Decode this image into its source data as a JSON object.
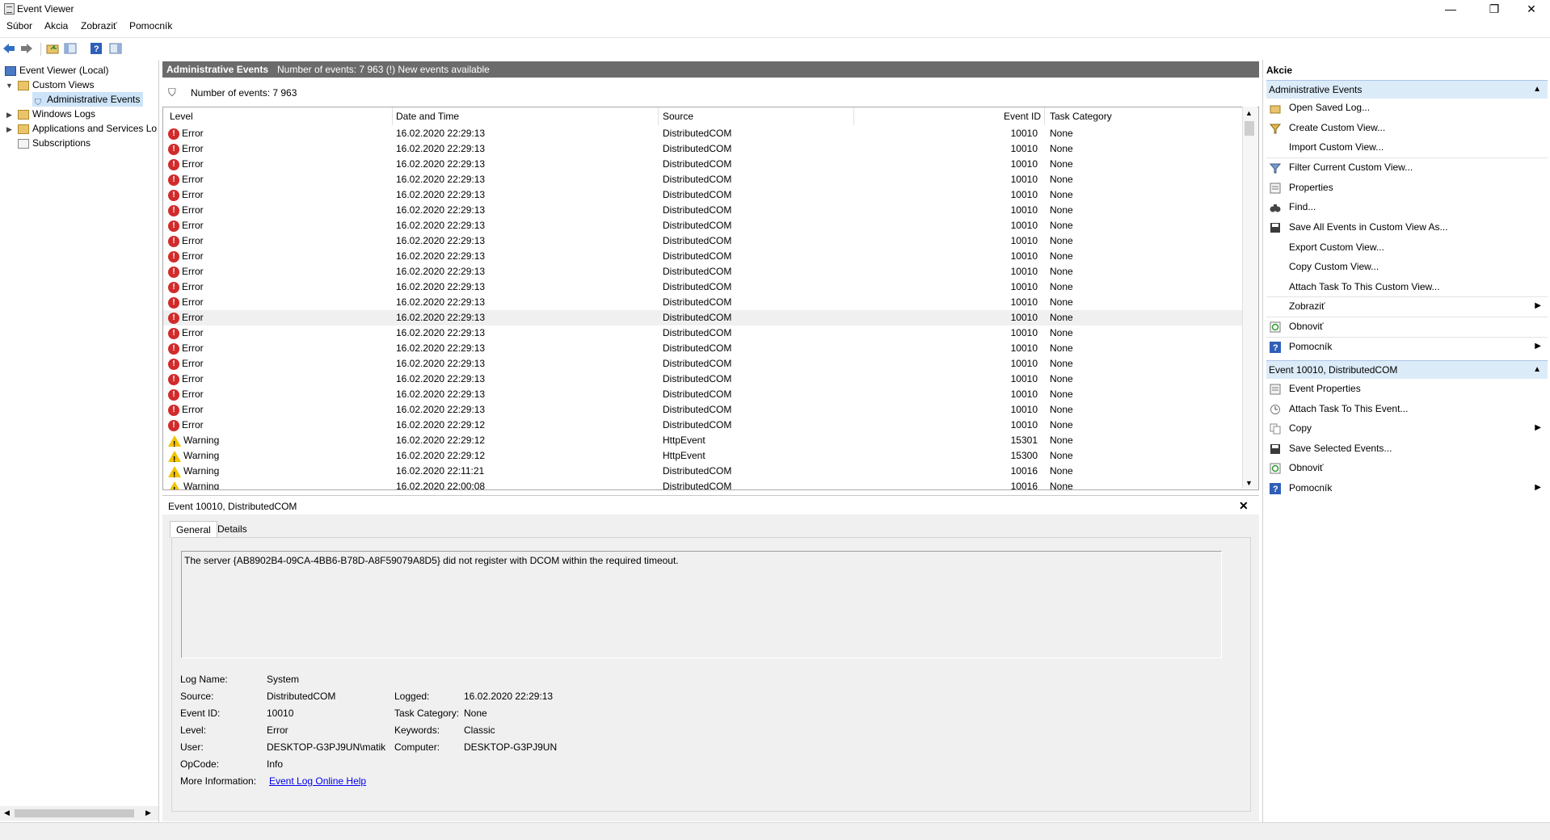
{
  "window": {
    "title": "Event Viewer",
    "minimize": "—",
    "restore": "❐",
    "close": "✕"
  },
  "menu": [
    "Súbor",
    "Akcia",
    "Zobraziť",
    "Pomocník"
  ],
  "tree": {
    "root": "Event Viewer (Local)",
    "custom_views": "Custom Views",
    "administrative_events": "Administrative Events",
    "windows_logs": "Windows Logs",
    "applications": "Applications and Services Lo",
    "subscriptions": "Subscriptions"
  },
  "center": {
    "header_title": "Administrative Events",
    "header_info": "Number of events: 7 963 (!) New events available",
    "filter_text": "Number of events: 7 963",
    "columns": {
      "level": "Level",
      "date": "Date and Time",
      "source": "Source",
      "event_id": "Event ID",
      "task": "Task Category"
    },
    "rows": [
      {
        "level": "Error",
        "date": "16.02.2020 22:29:13",
        "source": "DistributedCOM",
        "id": "10010",
        "task": "None"
      },
      {
        "level": "Error",
        "date": "16.02.2020 22:29:13",
        "source": "DistributedCOM",
        "id": "10010",
        "task": "None"
      },
      {
        "level": "Error",
        "date": "16.02.2020 22:29:13",
        "source": "DistributedCOM",
        "id": "10010",
        "task": "None"
      },
      {
        "level": "Error",
        "date": "16.02.2020 22:29:13",
        "source": "DistributedCOM",
        "id": "10010",
        "task": "None"
      },
      {
        "level": "Error",
        "date": "16.02.2020 22:29:13",
        "source": "DistributedCOM",
        "id": "10010",
        "task": "None"
      },
      {
        "level": "Error",
        "date": "16.02.2020 22:29:13",
        "source": "DistributedCOM",
        "id": "10010",
        "task": "None"
      },
      {
        "level": "Error",
        "date": "16.02.2020 22:29:13",
        "source": "DistributedCOM",
        "id": "10010",
        "task": "None"
      },
      {
        "level": "Error",
        "date": "16.02.2020 22:29:13",
        "source": "DistributedCOM",
        "id": "10010",
        "task": "None"
      },
      {
        "level": "Error",
        "date": "16.02.2020 22:29:13",
        "source": "DistributedCOM",
        "id": "10010",
        "task": "None"
      },
      {
        "level": "Error",
        "date": "16.02.2020 22:29:13",
        "source": "DistributedCOM",
        "id": "10010",
        "task": "None"
      },
      {
        "level": "Error",
        "date": "16.02.2020 22:29:13",
        "source": "DistributedCOM",
        "id": "10010",
        "task": "None"
      },
      {
        "level": "Error",
        "date": "16.02.2020 22:29:13",
        "source": "DistributedCOM",
        "id": "10010",
        "task": "None"
      },
      {
        "level": "Error",
        "date": "16.02.2020 22:29:13",
        "source": "DistributedCOM",
        "id": "10010",
        "task": "None",
        "selected": true
      },
      {
        "level": "Error",
        "date": "16.02.2020 22:29:13",
        "source": "DistributedCOM",
        "id": "10010",
        "task": "None"
      },
      {
        "level": "Error",
        "date": "16.02.2020 22:29:13",
        "source": "DistributedCOM",
        "id": "10010",
        "task": "None"
      },
      {
        "level": "Error",
        "date": "16.02.2020 22:29:13",
        "source": "DistributedCOM",
        "id": "10010",
        "task": "None"
      },
      {
        "level": "Error",
        "date": "16.02.2020 22:29:13",
        "source": "DistributedCOM",
        "id": "10010",
        "task": "None"
      },
      {
        "level": "Error",
        "date": "16.02.2020 22:29:13",
        "source": "DistributedCOM",
        "id": "10010",
        "task": "None"
      },
      {
        "level": "Error",
        "date": "16.02.2020 22:29:13",
        "source": "DistributedCOM",
        "id": "10010",
        "task": "None"
      },
      {
        "level": "Error",
        "date": "16.02.2020 22:29:12",
        "source": "DistributedCOM",
        "id": "10010",
        "task": "None"
      },
      {
        "level": "Warning",
        "date": "16.02.2020 22:29:12",
        "source": "HttpEvent",
        "id": "15301",
        "task": "None"
      },
      {
        "level": "Warning",
        "date": "16.02.2020 22:29:12",
        "source": "HttpEvent",
        "id": "15300",
        "task": "None"
      },
      {
        "level": "Warning",
        "date": "16.02.2020 22:11:21",
        "source": "DistributedCOM",
        "id": "10016",
        "task": "None"
      },
      {
        "level": "Warning",
        "date": "16.02.2020 22:00:08",
        "source": "DistributedCOM",
        "id": "10016",
        "task": "None"
      }
    ]
  },
  "detail": {
    "title": "Event 10010, DistributedCOM",
    "close": "✕",
    "tabs": {
      "general": "General",
      "details": "Details"
    },
    "message": "The server {AB8902B4-09CA-4BB6-B78D-A8F59079A8D5} did not register with DCOM within the required timeout.",
    "labels": {
      "log_name": "Log Name:",
      "source": "Source:",
      "event_id": "Event ID:",
      "level": "Level:",
      "user": "User:",
      "opcode": "OpCode:",
      "more_info": "More Information:",
      "logged": "Logged:",
      "task_category": "Task Category:",
      "keywords": "Keywords:",
      "computer": "Computer:"
    },
    "values": {
      "log_name": "System",
      "source": "DistributedCOM",
      "event_id": "10010",
      "level": "Error",
      "user": "DESKTOP-G3PJ9UN\\matik",
      "opcode": "Info",
      "more_info": "Event Log Online Help",
      "logged": "16.02.2020 22:29:13",
      "task_category": "None",
      "keywords": "Classic",
      "computer": "DESKTOP-G3PJ9UN"
    }
  },
  "actions": {
    "title": "Akcie",
    "section1": "Administrative Events",
    "items1": [
      "Open Saved Log...",
      "Create Custom View...",
      "Import Custom View...",
      "Filter Current Custom View...",
      "Properties",
      "Find...",
      "Save All Events in Custom View As...",
      "Export Custom View...",
      "Copy Custom View...",
      "Attach Task To This Custom View...",
      "Zobraziť",
      "Obnoviť",
      "Pomocník"
    ],
    "section2": "Event 10010, DistributedCOM",
    "items2": [
      "Event Properties",
      "Attach Task To This Event...",
      "Copy",
      "Save Selected Events...",
      "Obnoviť",
      "Pomocník"
    ]
  },
  "colors": {
    "header_bg": "#6b6b6b",
    "section_bg": "#dcebf8",
    "error": "#d12b2b",
    "warning": "#f2c200",
    "link": "#0000ee"
  }
}
